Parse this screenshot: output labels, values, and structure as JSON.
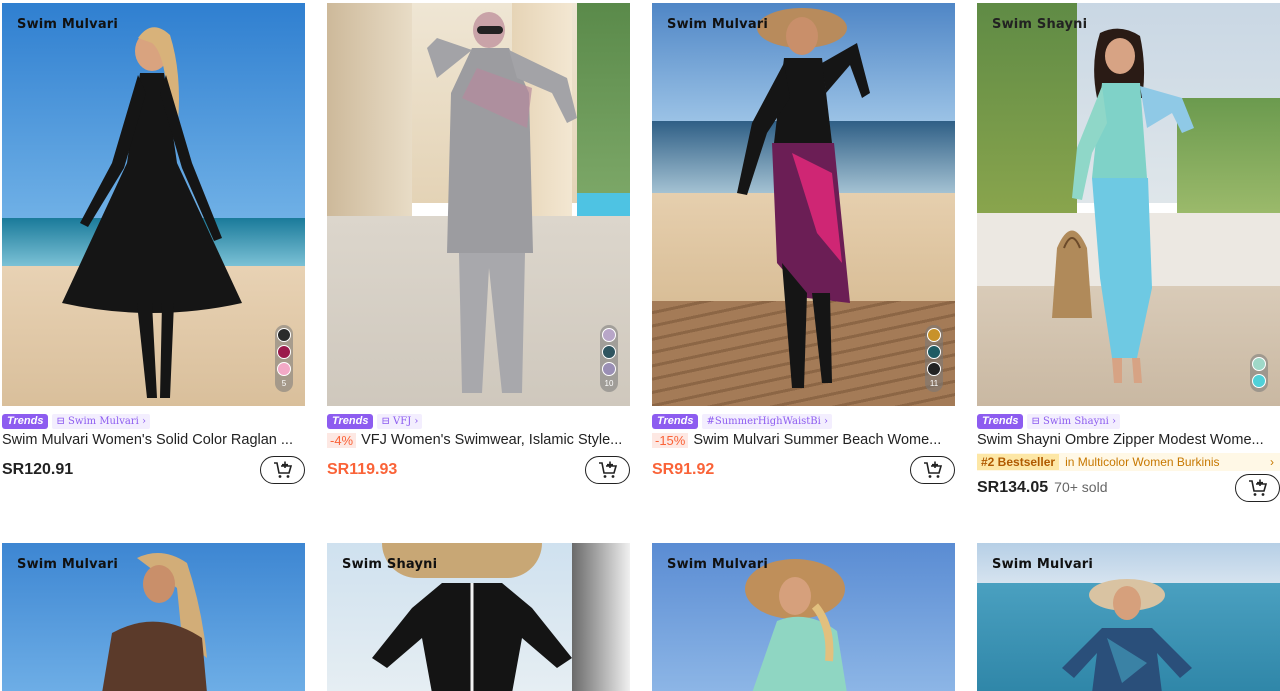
{
  "products": [
    {
      "brand_mark": "Swim Mulvari",
      "trends_label": "Trends",
      "store": "Swim Mulvari",
      "title": "Swim Mulvari Women's Solid Color Raglan ...",
      "discount": "",
      "price": "SR120.91",
      "swatch_count": "5",
      "swatches": [
        "#2b2b2b",
        "#9b1b4c",
        "#f2a9c6"
      ]
    },
    {
      "brand_mark": "",
      "trends_label": "Trends",
      "store": "VFJ",
      "title": "VFJ Women's Swimwear, Islamic Style...",
      "discount": "-4%",
      "price": "SR119.93",
      "swatch_count": "10",
      "swatches": [
        "#b8a6c8",
        "#2f5560",
        "#9a8fb5"
      ]
    },
    {
      "brand_mark": "Swim Mulvari",
      "trends_label": "Trends",
      "store": "#SummerHighWaistBi",
      "title": "Swim Mulvari Summer Beach Wome...",
      "discount": "-15%",
      "price": "SR91.92",
      "swatch_count": "11",
      "swatches": [
        "#c8922a",
        "#1f5b63",
        "#222222"
      ]
    },
    {
      "brand_mark": "Swim Shayni",
      "trends_label": "Trends",
      "store": "Swim Shayni",
      "title": "Swim Shayni Ombre Zipper Modest Wome...",
      "discount": "",
      "price": "SR134.05",
      "sold": "70+ sold",
      "bestseller": "#2 Bestseller",
      "bestseller_category": "in Multicolor Women Burkinis",
      "swatches": [
        "#9fd8c8",
        "#4fd0d8"
      ]
    },
    {
      "brand_mark": "Swim Mulvari"
    },
    {
      "brand_mark": "Swim Shayni"
    },
    {
      "brand_mark": "Swim Mulvari"
    },
    {
      "brand_mark": "Swim Mulvari"
    }
  ],
  "icons": {
    "cart": "add-to-cart-icon",
    "store": "store-icon",
    "chevron": "chevron-right-icon"
  },
  "colors": {
    "accent_purple": "#8d5cf0",
    "sale_orange": "#fa6338",
    "bestseller_text": "#c77800"
  }
}
